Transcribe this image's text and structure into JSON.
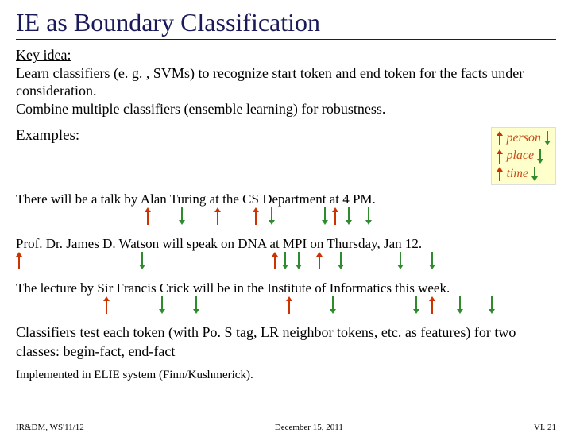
{
  "title": "IE as Boundary Classification",
  "key_idea_label": "Key idea:",
  "key_idea_text": "Learn classifiers (e. g. , SVMs) to recognize start token and end token for the facts under consideration.\nCombine multiple classifiers (ensemble learning) for robustness.",
  "examples_label": "Examples:",
  "legend": {
    "person": "person",
    "place": "place",
    "time": "time"
  },
  "sentences": {
    "s1": "There will be a talk by Alan Turing at the CS Department at 4 PM.",
    "s2": "Prof. Dr. James D. Watson will speak on DNA at MPI on Thursday, Jan 12.",
    "s3": "The lecture by Sir Francis Crick will be in the Institute of Informatics this week."
  },
  "bottom_text": "Classifiers test each token (with Po. S tag, LR neighbor tokens, etc. as features) for two classes: begin-fact, end-fact",
  "impl": "Implemented in ELIE system (Finn/Kushmerick).",
  "footer": {
    "left": "IR&DM, WS'11/12",
    "center": "December 15, 2011",
    "right": "VI. 21"
  }
}
